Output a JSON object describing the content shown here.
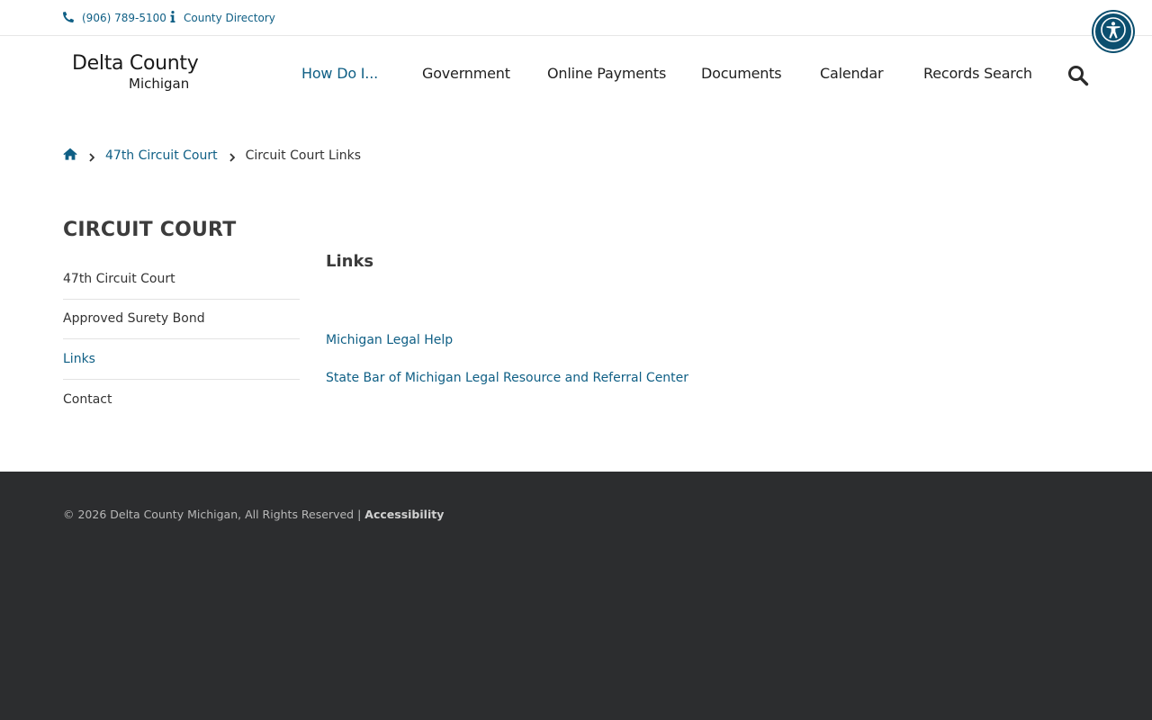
{
  "topbar": {
    "phone_icon": "phone-icon",
    "phone": "(906) 789-5100",
    "info_icon": "info-icon",
    "directory": "County Directory"
  },
  "accessibility_widget": {
    "icon": "accessibility-person-icon"
  },
  "logo": {
    "line1": "Delta County",
    "line2": "Michigan"
  },
  "nav": {
    "items": [
      {
        "label": "How Do I..."
      },
      {
        "label": "Government"
      },
      {
        "label": "Online Payments"
      },
      {
        "label": "Documents"
      },
      {
        "label": "Calendar"
      },
      {
        "label": "Records Search"
      }
    ],
    "search_icon": "search-icon"
  },
  "breadcrumb": {
    "home_icon": "home-icon",
    "separator_icon": "chevron-right-icon",
    "parent": "47th Circuit Court",
    "current": "Circuit Court Links"
  },
  "sidebar": {
    "title": "CIRCUIT COURT",
    "items": [
      {
        "label": "47th Circuit Court"
      },
      {
        "label": "Approved Surety Bond"
      },
      {
        "label": "Links"
      },
      {
        "label": "Contact"
      }
    ]
  },
  "main": {
    "title": "Links",
    "links": [
      {
        "label": "Michigan Legal Help"
      },
      {
        "label": "State Bar of Michigan Legal Resource and Referral Center"
      }
    ]
  },
  "footer": {
    "copyright": "© 2026 Delta County Michigan, All Rights Reserved |",
    "accessibility": "Accessibility"
  },
  "colors": {
    "accent": "#0f5f85",
    "footer_bg": "#2c2d2f",
    "a11y_button": "#0c4f6f"
  }
}
